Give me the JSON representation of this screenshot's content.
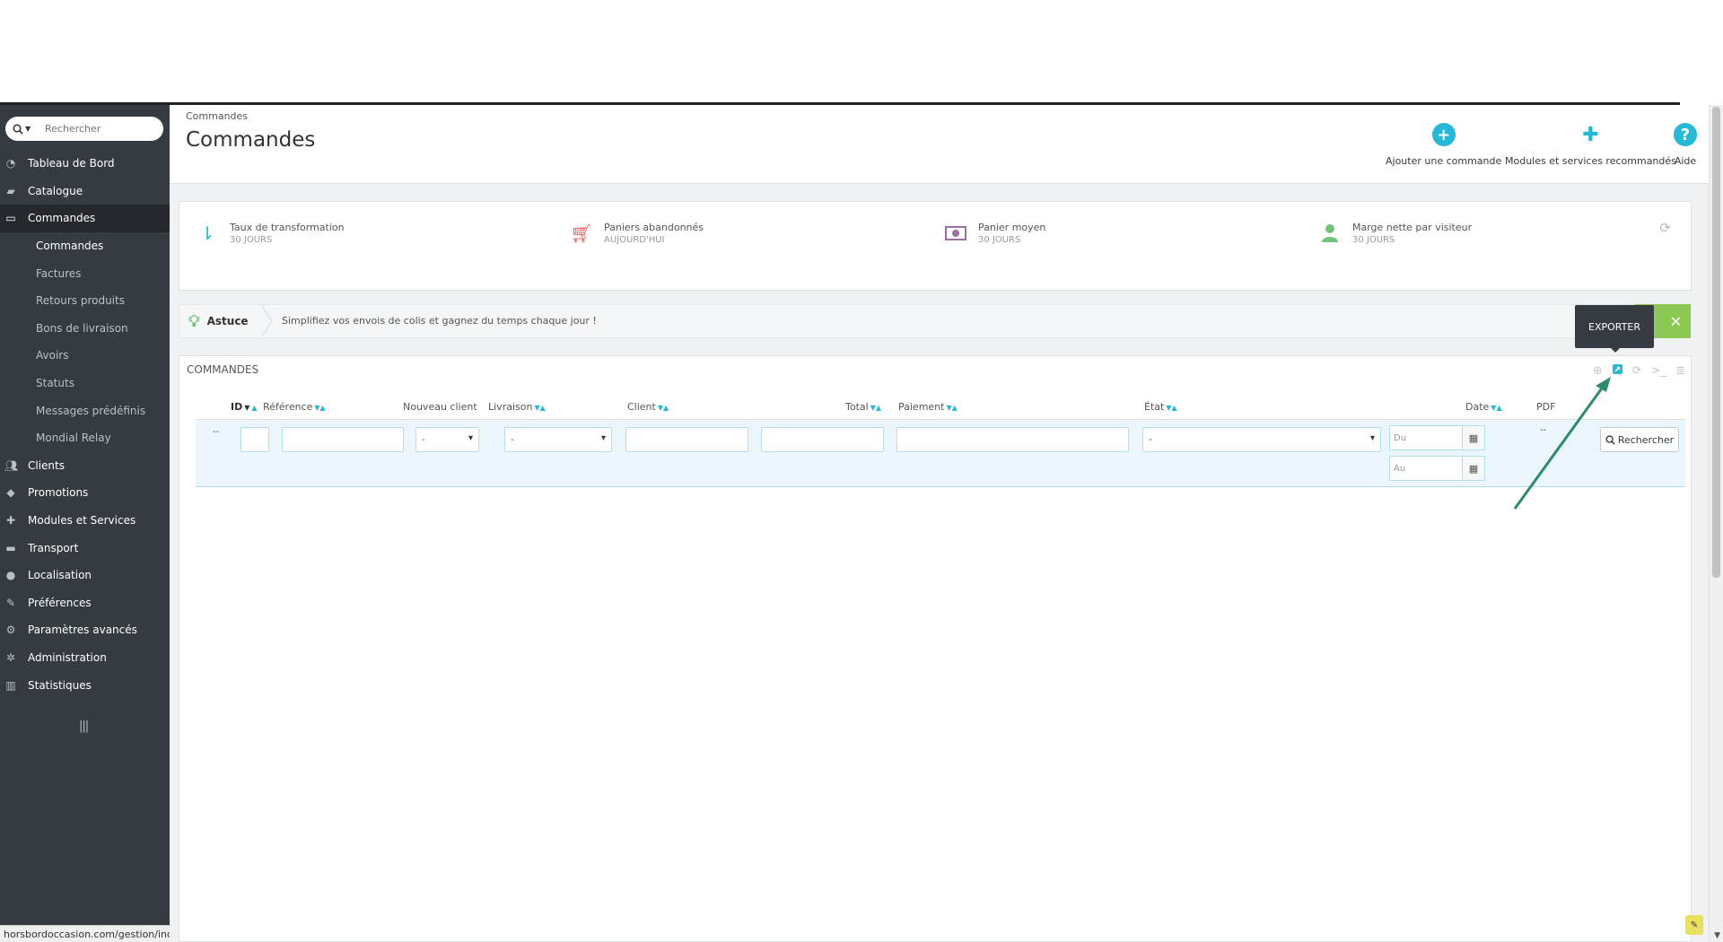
{
  "search": {
    "placeholder": "Rechercher"
  },
  "sidebar": {
    "items": [
      {
        "label": "Tableau de Bord",
        "icon": "dashboard-icon"
      },
      {
        "label": "Catalogue",
        "icon": "book-icon"
      },
      {
        "label": "Commandes",
        "icon": "credit-card-icon",
        "active": true
      },
      {
        "label": "Clients",
        "icon": "users-icon"
      },
      {
        "label": "Promotions",
        "icon": "tags-icon"
      },
      {
        "label": "Modules et Services",
        "icon": "puzzle-icon"
      },
      {
        "label": "Transport",
        "icon": "truck-icon"
      },
      {
        "label": "Localisation",
        "icon": "globe-icon"
      },
      {
        "label": "Préférences",
        "icon": "wrench-icon"
      },
      {
        "label": "Paramètres avancés",
        "icon": "cogs-icon"
      },
      {
        "label": "Administration",
        "icon": "cog-icon"
      },
      {
        "label": "Statistiques",
        "icon": "bar-chart-icon"
      }
    ],
    "subitems": [
      "Commandes",
      "Factures",
      "Retours produits",
      "Bons de livraison",
      "Avoirs",
      "Statuts",
      "Messages prédéfinis",
      "Mondial Relay"
    ]
  },
  "status_url": "horsbordoccasion.com/gestion/index.p",
  "header": {
    "breadcrumb": "Commandes",
    "title": "Commandes",
    "toolbar": {
      "add_label": "Ajouter une commande",
      "modules_label": "Modules et services recommandés",
      "help_label": "Aide"
    }
  },
  "kpis": [
    {
      "title": "Taux de transformation",
      "sub": "30 JOURS",
      "color": "#25b9d7"
    },
    {
      "title": "Paniers abandonnés",
      "sub": "AUJOURD'HUI",
      "color": "#e15c5c"
    },
    {
      "title": "Panier moyen",
      "sub": "30 JOURS",
      "color": "#9f6fa4"
    },
    {
      "title": "Marge nette par visiteur",
      "sub": "30 JOURS",
      "color": "#72c279"
    }
  ],
  "tip": {
    "label": "Astuce",
    "text": "Simplifiez vos envois de colis et gagnez du temps chaque jour !"
  },
  "tooltip": {
    "text": "EXPORTER"
  },
  "orders": {
    "panel_title": "COMMANDES",
    "columns": [
      "ID",
      "Référence",
      "Nouveau client",
      "Livraison",
      "Client",
      "Total",
      "Paiement",
      "État",
      "Date",
      "PDF"
    ],
    "filters": {
      "id_dash": "--",
      "nouveau_client": "-",
      "livraison": "-",
      "etat": "-",
      "date_from": "Du",
      "date_to": "Au",
      "pdf_dash": "--",
      "search_button": "Rechercher"
    }
  },
  "colors": {
    "accent": "#25b9d7",
    "sidebar": "#363a41",
    "tip_green": "#8bc954",
    "arrow": "#2e8b6a"
  }
}
